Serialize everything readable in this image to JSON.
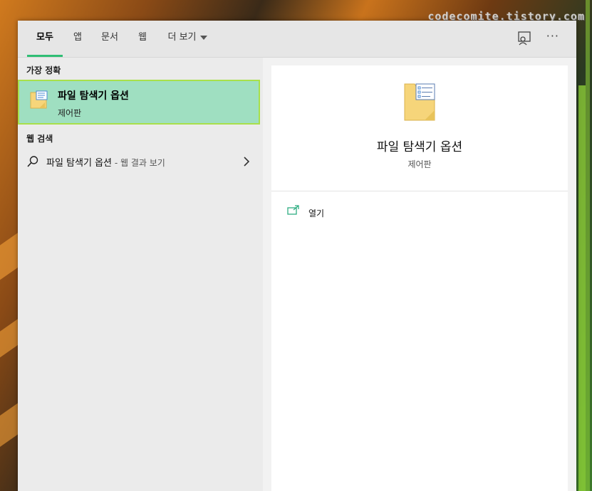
{
  "watermark": "codecomite.tistory.com",
  "tabs": [
    {
      "label": "모두",
      "active": true
    },
    {
      "label": "앱"
    },
    {
      "label": "문서"
    },
    {
      "label": "웹"
    },
    {
      "label": "더 보기"
    }
  ],
  "toolbar": {
    "more_label": "···"
  },
  "left": {
    "best_match_heading": "가장 정확",
    "best_match": {
      "title": "파일 탐색기 옵션",
      "subtitle": "제어판"
    },
    "web_heading": "웹 검색",
    "web_result": {
      "query": "파일 탐색기 옵션",
      "hint": " - 웹 결과 보기"
    }
  },
  "right": {
    "title": "파일 탐색기 옵션",
    "subtitle": "제어판",
    "actions": [
      {
        "label": "열기"
      }
    ]
  },
  "colors": {
    "accent": "#2fbe74",
    "highlight": "#9fdfc1",
    "highlight_border": "#a8e04a"
  }
}
